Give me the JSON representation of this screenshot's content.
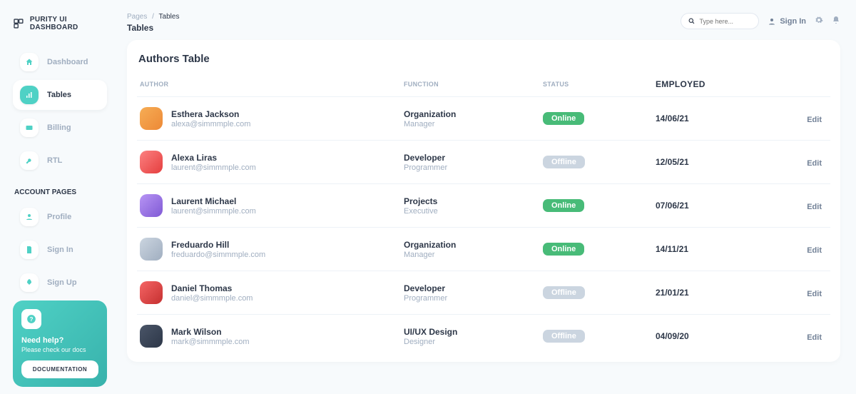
{
  "brand": "PURITY UI DASHBOARD",
  "sidebar": {
    "items": [
      {
        "label": "Dashboard"
      },
      {
        "label": "Tables"
      },
      {
        "label": "Billing"
      },
      {
        "label": "RTL"
      }
    ],
    "section_label": "ACCOUNT PAGES",
    "account_items": [
      {
        "label": "Profile"
      },
      {
        "label": "Sign In"
      },
      {
        "label": "Sign Up"
      }
    ]
  },
  "help": {
    "title": "Need help?",
    "subtitle": "Please check our docs",
    "button": "DOCUMENTATION"
  },
  "breadcrumbs": {
    "root": "Pages",
    "current": "Tables"
  },
  "page_title": "Tables",
  "search": {
    "placeholder": "Type here..."
  },
  "signin_label": "Sign In",
  "table": {
    "title": "Authors Table",
    "headers": {
      "author": "AUTHOR",
      "function": "FUNCTION",
      "status": "STATUS",
      "employed": "EMPLOYED"
    },
    "edit_label": "Edit",
    "rows": [
      {
        "name": "Esthera Jackson",
        "email": "alexa@simmmple.com",
        "func": "Organization",
        "sub": "Manager",
        "status": "Online",
        "date": "14/06/21"
      },
      {
        "name": "Alexa Liras",
        "email": "laurent@simmmple.com",
        "func": "Developer",
        "sub": "Programmer",
        "status": "Offline",
        "date": "12/05/21"
      },
      {
        "name": "Laurent Michael",
        "email": "laurent@simmmple.com",
        "func": "Projects",
        "sub": "Executive",
        "status": "Online",
        "date": "07/06/21"
      },
      {
        "name": "Freduardo Hill",
        "email": "freduardo@simmmple.com",
        "func": "Organization",
        "sub": "Manager",
        "status": "Online",
        "date": "14/11/21"
      },
      {
        "name": "Daniel Thomas",
        "email": "daniel@simmmple.com",
        "func": "Developer",
        "sub": "Programmer",
        "status": "Offline",
        "date": "21/01/21"
      },
      {
        "name": "Mark Wilson",
        "email": "mark@simmmple.com",
        "func": "UI/UX Design",
        "sub": "Designer",
        "status": "Offline",
        "date": "04/09/20"
      }
    ]
  }
}
